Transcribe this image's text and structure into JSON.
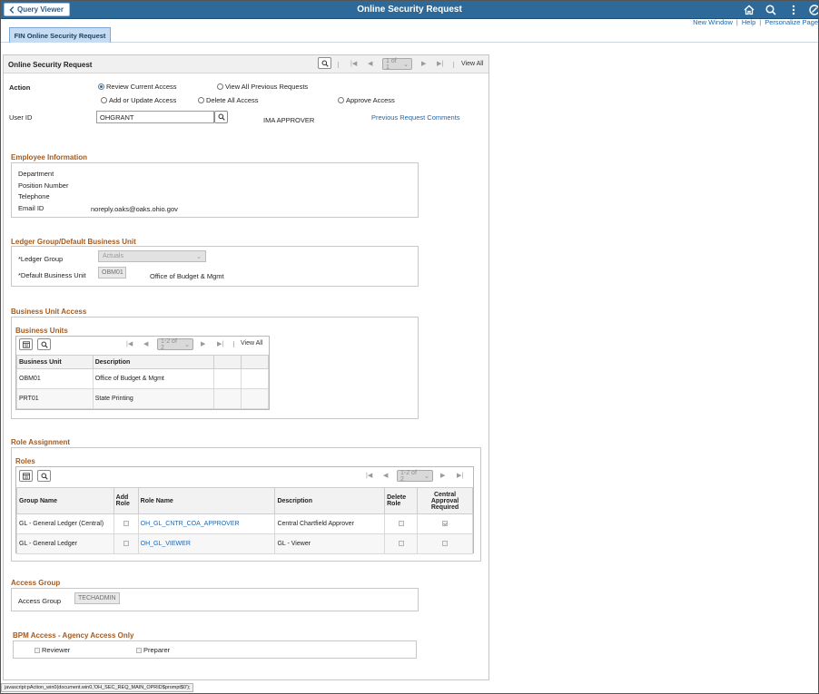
{
  "header": {
    "back_label": "Query Viewer",
    "title": "Online Security Request",
    "icons": [
      "home-icon",
      "search-icon",
      "actions-menu-icon",
      "navbar-icon"
    ],
    "colors": {
      "bar": "#2d6a9a",
      "link": "#1b66b1",
      "section": "#a45a1f"
    }
  },
  "toplinks": {
    "new_window": "New Window",
    "help": "Help",
    "personalize": "Personalize Page",
    "sep": "|"
  },
  "tab": {
    "label": "FIN Online Security Request"
  },
  "panel": {
    "title": "Online Security Request",
    "pager": {
      "range": "1 of 1",
      "view_all": "View All"
    }
  },
  "action": {
    "label": "Action",
    "options": [
      {
        "label": "Review Current Access",
        "selected": true
      },
      {
        "label": "View All Previous Requests",
        "selected": false
      },
      {
        "label": "Add or Update Access",
        "selected": false
      },
      {
        "label": "Delete All Access",
        "selected": false
      },
      {
        "label": "Approve Access",
        "selected": false
      }
    ]
  },
  "user": {
    "label": "User ID",
    "value": "OHGRANT",
    "role_text": "IMA APPROVER",
    "comments_link": "Previous Request Comments"
  },
  "employee": {
    "title": "Employee Information",
    "department_label": "Department",
    "position_label": "Position Number",
    "telephone_label": "Telephone",
    "email_label": "Email ID",
    "email_value": "noreply.oaks@oaks.ohio.gov"
  },
  "ledger": {
    "title": "Ledger Group/Default Business Unit",
    "group_label": "*Ledger Group",
    "group_value": "Actuals",
    "bu_label": "*Default Business Unit",
    "bu_value": "OBM01",
    "bu_desc": "Office of Budget & Mgmt"
  },
  "bu_access": {
    "title": "Business Unit Access",
    "grid_title": "Business Units",
    "pager": {
      "range": "1-2 of 2",
      "view_all": "View All"
    },
    "columns": [
      "Business Unit",
      "Description"
    ],
    "rows": [
      {
        "unit": "OBM01",
        "desc": "Office of Budget & Mgmt"
      },
      {
        "unit": "PRT01",
        "desc": "State Printing"
      }
    ]
  },
  "roles": {
    "title": "Role Assignment",
    "grid_title": "Roles",
    "pager": {
      "range": "1-2 of 2"
    },
    "columns": {
      "group": "Group Name",
      "add": "Add Role",
      "role": "Role Name",
      "desc": "Description",
      "delete": "Delete Role",
      "central": "Central Approval Required"
    },
    "rows": [
      {
        "group": "GL - General Ledger (Central)",
        "add": false,
        "role": "OH_GL_CNTR_COA_APPROVER",
        "desc": "Central Chartfield Approver",
        "delete": false,
        "central": true
      },
      {
        "group": "GL - General Ledger",
        "add": false,
        "role": "OH_GL_VIEWER",
        "desc": "GL -  Viewer",
        "delete": false,
        "central": false
      }
    ]
  },
  "access_group": {
    "title": "Access Group",
    "label": "Access Group",
    "value": "TECHADMIN"
  },
  "bpm": {
    "title": "BPM Access - Agency Access Only",
    "reviewer": "Reviewer",
    "preparer": "Preparer"
  },
  "status": {
    "text": "javascript:pAction_win0(document.win0,'OH_SEC_REQ_MAIN_OPRID$prompt$0');"
  }
}
